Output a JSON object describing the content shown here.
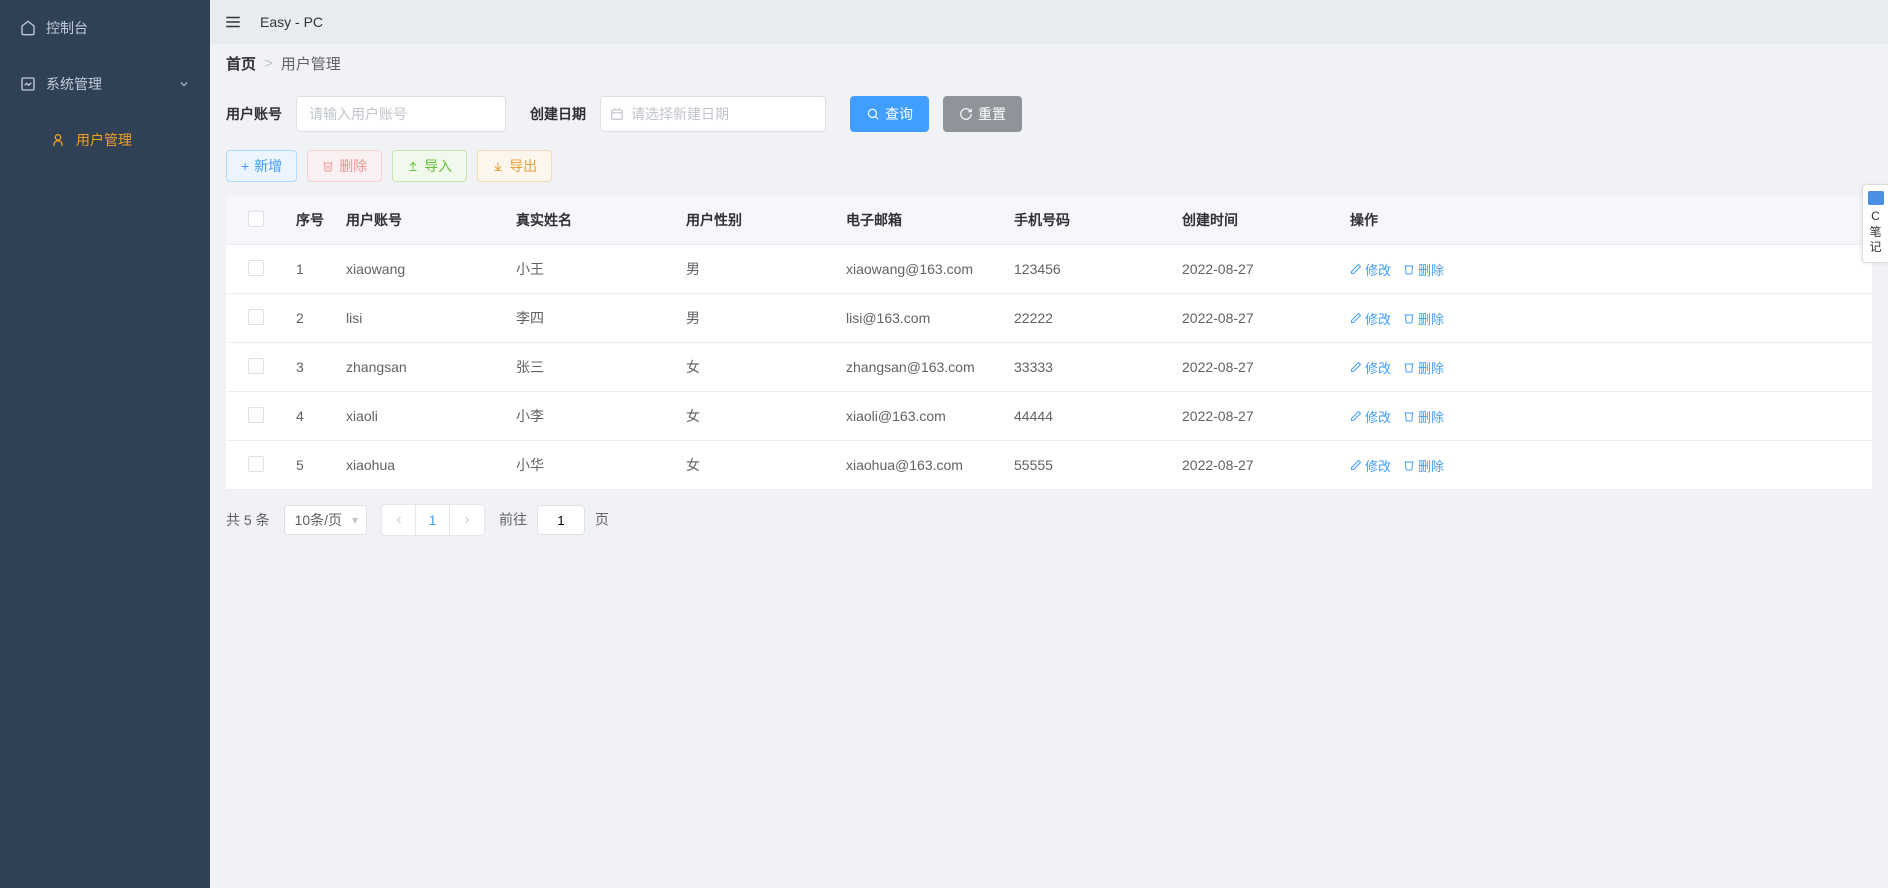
{
  "app": {
    "title": "Easy - PC"
  },
  "sidebar": {
    "console": "控制台",
    "system": "系统管理",
    "user_mgmt": "用户管理"
  },
  "breadcrumb": {
    "home": "首页",
    "sep": ">",
    "current": "用户管理"
  },
  "search": {
    "account_label": "用户账号",
    "account_placeholder": "请输入用户账号",
    "date_label": "创建日期",
    "date_placeholder": "请选择新建日期",
    "query_btn": "查询",
    "reset_btn": "重置"
  },
  "toolbar": {
    "add": "新增",
    "delete": "删除",
    "import": "导入",
    "export": "导出"
  },
  "table": {
    "headers": {
      "index": "序号",
      "account": "用户账号",
      "realname": "真实姓名",
      "gender": "用户性别",
      "email": "电子邮箱",
      "phone": "手机号码",
      "created": "创建时间",
      "ops": "操作"
    },
    "rows": [
      {
        "idx": "1",
        "account": "xiaowang",
        "realname": "小王",
        "gender": "男",
        "email": "xiaowang@163.com",
        "phone": "123456",
        "created": "2022-08-27"
      },
      {
        "idx": "2",
        "account": "lisi",
        "realname": "李四",
        "gender": "男",
        "email": "lisi@163.com",
        "phone": "22222",
        "created": "2022-08-27"
      },
      {
        "idx": "3",
        "account": "zhangsan",
        "realname": "张三",
        "gender": "女",
        "email": "zhangsan@163.com",
        "phone": "33333",
        "created": "2022-08-27"
      },
      {
        "idx": "4",
        "account": "xiaoli",
        "realname": "小李",
        "gender": "女",
        "email": "xiaoli@163.com",
        "phone": "44444",
        "created": "2022-08-27"
      },
      {
        "idx": "5",
        "account": "xiaohua",
        "realname": "小华",
        "gender": "女",
        "email": "xiaohua@163.com",
        "phone": "55555",
        "created": "2022-08-27"
      }
    ],
    "ops": {
      "edit": "修改",
      "delete": "删除"
    }
  },
  "pagination": {
    "total_prefix": "共",
    "total_count": "5",
    "total_suffix": "条",
    "page_size": "10条/页",
    "current_page": "1",
    "goto_label": "前往",
    "goto_value": "1",
    "goto_suffix": "页"
  },
  "float": {
    "line1": "C",
    "line2": "笔",
    "line3": "记"
  }
}
